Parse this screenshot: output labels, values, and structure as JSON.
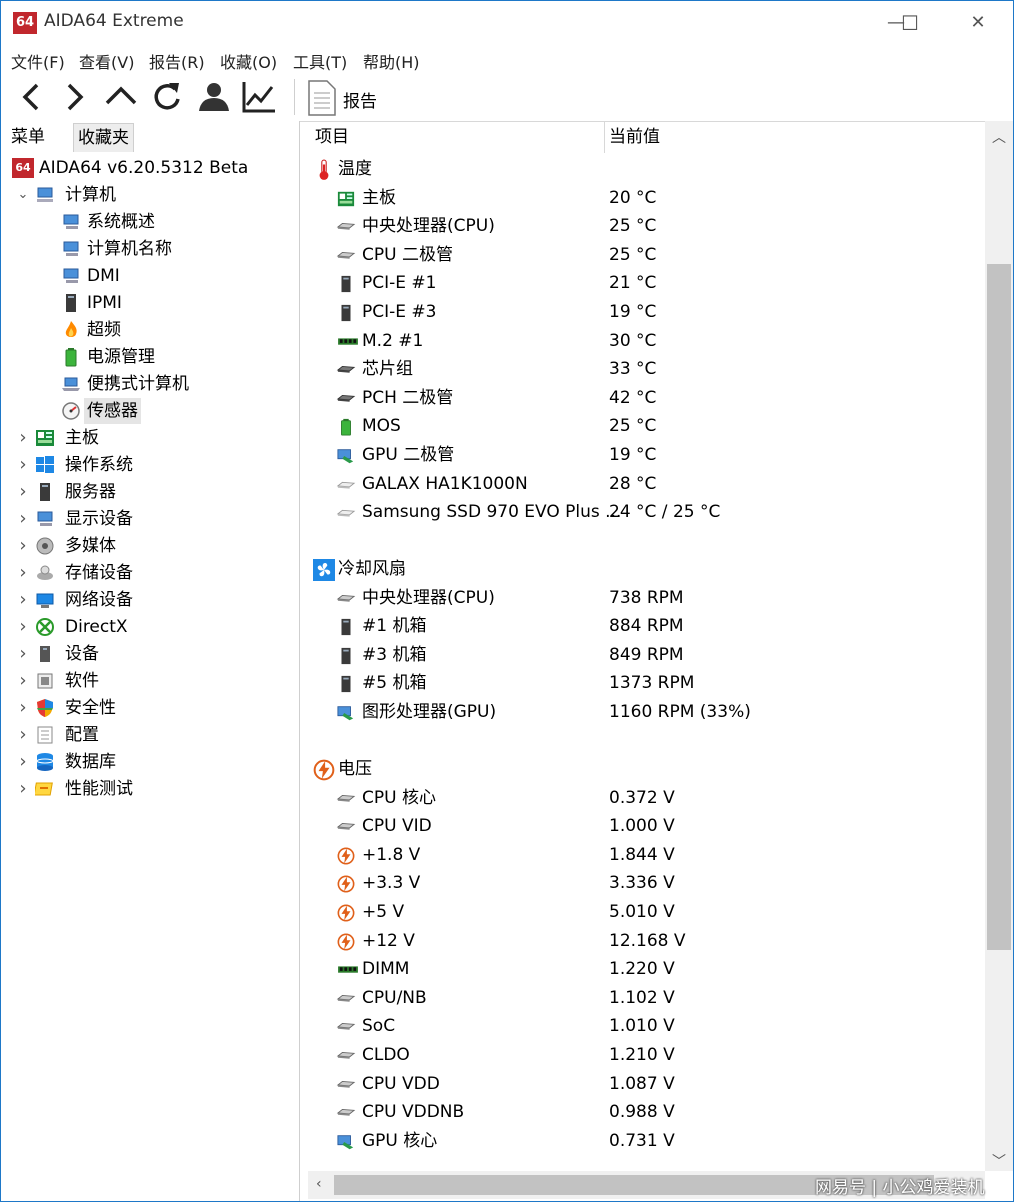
{
  "window": {
    "logo_text": "64",
    "title": "AIDA64 Extreme",
    "minimize": "—",
    "maximize": "☐",
    "close": "✕"
  },
  "menu": [
    "文件(F)",
    "查看(V)",
    "报告(R)",
    "收藏(O)",
    "工具(T)",
    "帮助(H)"
  ],
  "toolbar": {
    "report_label": "报告"
  },
  "left": {
    "tabs": {
      "menu": "菜单",
      "favorites": "收藏夹"
    },
    "root": "AIDA64 v6.20.5312 Beta",
    "computer": "计算机",
    "computer_children": [
      "系统概述",
      "计算机名称",
      "DMI",
      "IPMI",
      "超频",
      "电源管理",
      "便携式计算机",
      "传感器"
    ],
    "categories": [
      "主板",
      "操作系统",
      "服务器",
      "显示设备",
      "多媒体",
      "存储设备",
      "网络设备",
      "DirectX",
      "设备",
      "软件",
      "安全性",
      "配置",
      "数据库",
      "性能测试"
    ]
  },
  "columns": {
    "item": "项目",
    "value": "当前值"
  },
  "sections": {
    "temperature": {
      "title": "温度",
      "rows": [
        {
          "name": "主板",
          "value": "20 °C",
          "icon": "motherboard"
        },
        {
          "name": "中央处理器(CPU)",
          "value": "25 °C",
          "icon": "chip"
        },
        {
          "name": "CPU 二极管",
          "value": "25 °C",
          "icon": "chip"
        },
        {
          "name": "PCI-E #1",
          "value": "21 °C",
          "icon": "tower"
        },
        {
          "name": "PCI-E #3",
          "value": "19 °C",
          "icon": "tower"
        },
        {
          "name": "M.2 #1",
          "value": "30 °C",
          "icon": "ram"
        },
        {
          "name": "芯片组",
          "value": "33 °C",
          "icon": "chipset"
        },
        {
          "name": "PCH 二极管",
          "value": "42 °C",
          "icon": "chipset"
        },
        {
          "name": "MOS",
          "value": "25 °C",
          "icon": "battery"
        },
        {
          "name": "GPU 二极管",
          "value": "19 °C",
          "icon": "gpu"
        },
        {
          "name": "GALAX HA1K1000N",
          "value": "28 °C",
          "icon": "drive"
        },
        {
          "name": "Samsung SSD 970 EVO Plus ...",
          "value": "24 °C / 25 °C",
          "icon": "drive"
        }
      ]
    },
    "fans": {
      "title": "冷却风扇",
      "rows": [
        {
          "name": "中央处理器(CPU)",
          "value": "738 RPM",
          "icon": "chip"
        },
        {
          "name": "#1 机箱",
          "value": "884 RPM",
          "icon": "tower"
        },
        {
          "name": "#3 机箱",
          "value": "849 RPM",
          "icon": "tower"
        },
        {
          "name": "#5 机箱",
          "value": "1373 RPM",
          "icon": "tower"
        },
        {
          "name": "图形处理器(GPU)",
          "value": "1160 RPM  (33%)",
          "icon": "gpu"
        }
      ]
    },
    "voltage": {
      "title": "电压",
      "rows": [
        {
          "name": "CPU 核心",
          "value": "0.372 V",
          "icon": "chip"
        },
        {
          "name": "CPU VID",
          "value": "1.000 V",
          "icon": "chip"
        },
        {
          "name": "+1.8 V",
          "value": "1.844 V",
          "icon": "bolt"
        },
        {
          "name": "+3.3 V",
          "value": "3.336 V",
          "icon": "bolt"
        },
        {
          "name": "+5 V",
          "value": "5.010 V",
          "icon": "bolt"
        },
        {
          "name": "+12 V",
          "value": "12.168 V",
          "icon": "bolt"
        },
        {
          "name": "DIMM",
          "value": "1.220 V",
          "icon": "ram"
        },
        {
          "name": "CPU/NB",
          "value": "1.102 V",
          "icon": "chip"
        },
        {
          "name": "SoC",
          "value": "1.010 V",
          "icon": "chip"
        },
        {
          "name": "CLDO",
          "value": "1.210 V",
          "icon": "chip"
        },
        {
          "name": "CPU VDD",
          "value": "1.087 V",
          "icon": "chip"
        },
        {
          "name": "CPU VDDNB",
          "value": "0.988 V",
          "icon": "chip"
        },
        {
          "name": "GPU 核心",
          "value": "0.731 V",
          "icon": "gpu"
        }
      ]
    }
  },
  "watermark": "网易号 | 小公鸡爱装机",
  "colors": {
    "accent": "#1e78c8",
    "logo": "#c1272d",
    "bolt": "#e0601a"
  }
}
